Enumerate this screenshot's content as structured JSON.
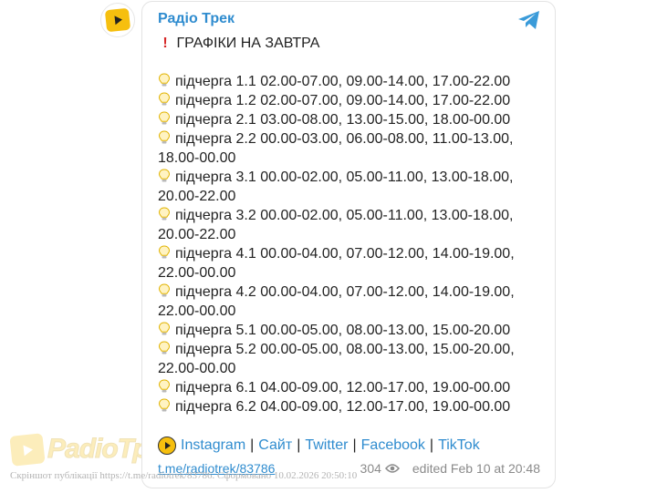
{
  "channel": {
    "name": "Радіо Трек"
  },
  "message": {
    "title": "ГРАФІКИ НА ЗАВТРА",
    "lines": [
      {
        "bulb": true,
        "text": "підчерга 1.1 02.00-07.00, 09.00-14.00, 17.00-22.00"
      },
      {
        "bulb": true,
        "text": "підчерга 1.2 02.00-07.00, 09.00-14.00, 17.00-22.00"
      },
      {
        "bulb": true,
        "text": "підчерга 2.1 03.00-08.00, 13.00-15.00, 18.00-00.00"
      },
      {
        "bulb": true,
        "text": "підчерга 2.2 00.00-03.00, 06.00-08.00, 11.00-13.00,"
      },
      {
        "bulb": false,
        "text": "18.00-00.00"
      },
      {
        "bulb": true,
        "text": "підчерга 3.1 00.00-02.00, 05.00-11.00, 13.00-18.00,"
      },
      {
        "bulb": false,
        "text": "20.00-22.00"
      },
      {
        "bulb": true,
        "text": "підчерга 3.2 00.00-02.00, 05.00-11.00, 13.00-18.00,"
      },
      {
        "bulb": false,
        "text": "20.00-22.00"
      },
      {
        "bulb": true,
        "text": "підчерга 4.1 00.00-04.00, 07.00-12.00, 14.00-19.00,"
      },
      {
        "bulb": false,
        "text": "22.00-00.00"
      },
      {
        "bulb": true,
        "text": "підчерга 4.2 00.00-04.00, 07.00-12.00, 14.00-19.00,"
      },
      {
        "bulb": false,
        "text": "22.00-00.00"
      },
      {
        "bulb": true,
        "text": "підчерга 5.1 00.00-05.00, 08.00-13.00, 15.00-20.00"
      },
      {
        "bulb": true,
        "text": "підчерга 5.2 00.00-05.00, 08.00-13.00, 15.00-20.00,"
      },
      {
        "bulb": false,
        "text": "22.00-00.00"
      },
      {
        "bulb": true,
        "text": "підчерга 6.1 04.00-09.00, 12.00-17.00, 19.00-00.00"
      },
      {
        "bulb": true,
        "text": "підчерга 6.2 04.00-09.00, 12.00-17.00, 19.00-00.00"
      }
    ],
    "links": [
      "Instagram",
      "Сайт",
      "Twitter",
      "Facebook",
      "TikTok"
    ],
    "separator": "|",
    "post_url": "t.me/radiotrek/83786",
    "views": "304",
    "edited": "edited  Feb 10 at 20:48"
  },
  "watermark": {
    "logo_text": "РаdiоТрек",
    "footnote": "Скріншот публікації https://t.me/radiotrek/83786. Сформовано 10.02.2026 20:50:10"
  },
  "icons": {
    "brand_color": "#f6bf0e",
    "link_color": "#2f8ccf",
    "telegram_icon": "paper-plane",
    "bulb_icon": "lightbulb",
    "alert_icon": "exclamation"
  }
}
